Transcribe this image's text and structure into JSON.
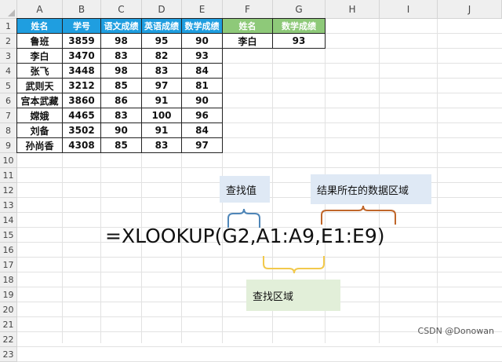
{
  "columns": [
    "A",
    "B",
    "C",
    "D",
    "E",
    "F",
    "G",
    "H",
    "I",
    "J"
  ],
  "rows": [
    "1",
    "2",
    "3",
    "4",
    "5",
    "6",
    "7",
    "8",
    "9",
    "10",
    "11",
    "12",
    "13",
    "14",
    "15",
    "16",
    "17",
    "18",
    "19",
    "20",
    "21",
    "22",
    "23"
  ],
  "main_table": {
    "headers": [
      "姓名",
      "学号",
      "语文成绩",
      "英语成绩",
      "数学成绩"
    ],
    "data": [
      [
        "鲁班",
        "3859",
        "98",
        "95",
        "90"
      ],
      [
        "李白",
        "3470",
        "83",
        "82",
        "93"
      ],
      [
        "张飞",
        "3448",
        "98",
        "83",
        "84"
      ],
      [
        "武则天",
        "3212",
        "85",
        "97",
        "81"
      ],
      [
        "宫本武藏",
        "3860",
        "86",
        "91",
        "90"
      ],
      [
        "嫦娥",
        "4465",
        "83",
        "100",
        "96"
      ],
      [
        "刘备",
        "3502",
        "90",
        "91",
        "84"
      ],
      [
        "孙尚香",
        "4308",
        "85",
        "83",
        "97"
      ]
    ]
  },
  "lookup_table": {
    "headers": [
      "姓名",
      "数学成绩"
    ],
    "data": [
      [
        "李白",
        "93"
      ]
    ]
  },
  "annotations": {
    "lookup_value": "查找值",
    "result_range": "结果所在的数据区域",
    "search_range": "查找区域"
  },
  "formula": "=XLOOKUP(G2,A1:A9,E1:E9)",
  "watermark": "CSDN @Donowan",
  "colors": {
    "header_blue": "#1f9ee0",
    "header_green": "#8ec979",
    "brace_blue": "#4f86b8",
    "brace_yellow": "#f2c94c",
    "brace_orange": "#c0662a"
  }
}
